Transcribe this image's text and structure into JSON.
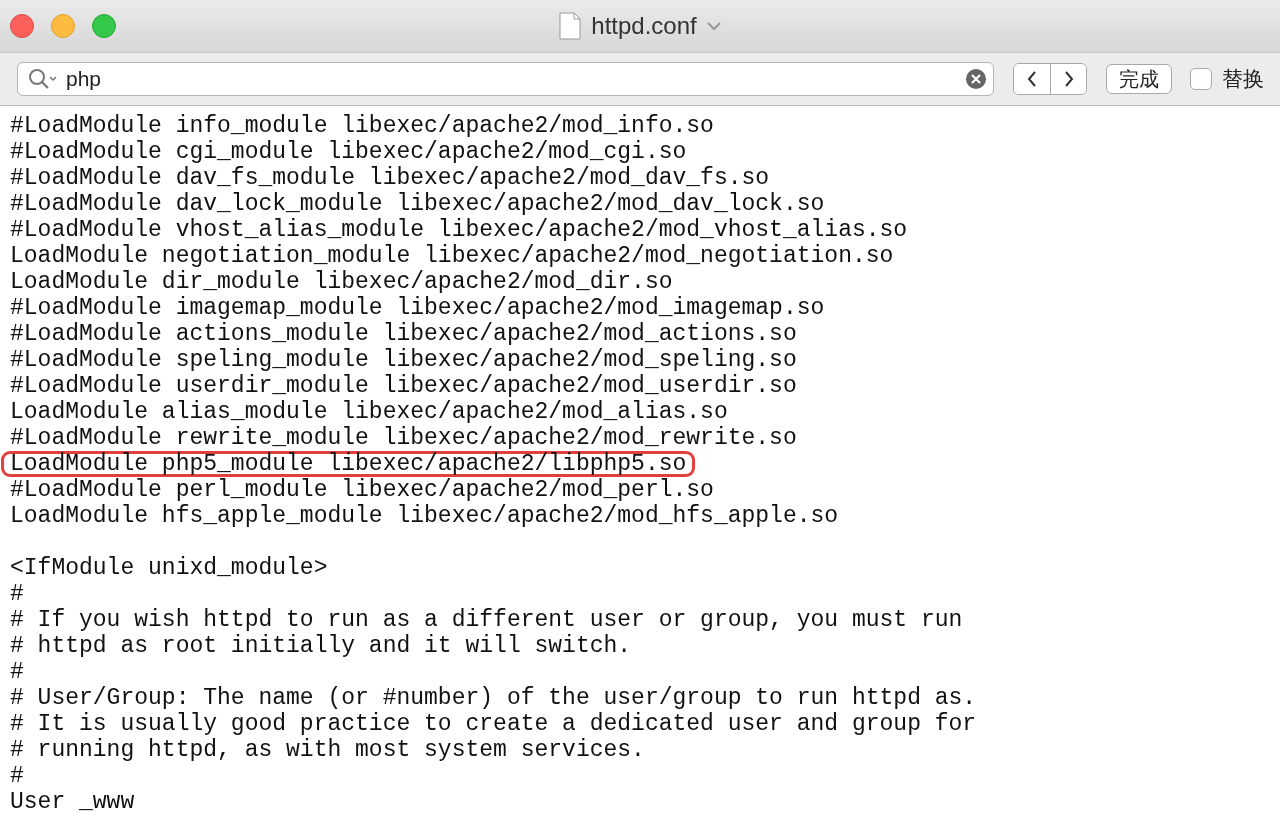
{
  "window": {
    "title": "httpd.conf"
  },
  "find_bar": {
    "query": "php",
    "done_button": "完成",
    "replace": {
      "label": "替换",
      "checked": false
    }
  },
  "lines": [
    {
      "kind": "code",
      "text": "#LoadModule info_module libexec/apache2/mod_info.so",
      "highlighted": false
    },
    {
      "kind": "code",
      "text": "#LoadModule cgi_module libexec/apache2/mod_cgi.so",
      "highlighted": false
    },
    {
      "kind": "code",
      "text": "#LoadModule dav_fs_module libexec/apache2/mod_dav_fs.so",
      "highlighted": false
    },
    {
      "kind": "code",
      "text": "#LoadModule dav_lock_module libexec/apache2/mod_dav_lock.so",
      "highlighted": false
    },
    {
      "kind": "code",
      "text": "#LoadModule vhost_alias_module libexec/apache2/mod_vhost_alias.so",
      "highlighted": false
    },
    {
      "kind": "code",
      "text": "LoadModule negotiation_module libexec/apache2/mod_negotiation.so",
      "highlighted": false
    },
    {
      "kind": "code",
      "text": "LoadModule dir_module libexec/apache2/mod_dir.so",
      "highlighted": false
    },
    {
      "kind": "code",
      "text": "#LoadModule imagemap_module libexec/apache2/mod_imagemap.so",
      "highlighted": false
    },
    {
      "kind": "code",
      "text": "#LoadModule actions_module libexec/apache2/mod_actions.so",
      "highlighted": false
    },
    {
      "kind": "code",
      "text": "#LoadModule speling_module libexec/apache2/mod_speling.so",
      "highlighted": false
    },
    {
      "kind": "code",
      "text": "#LoadModule userdir_module libexec/apache2/mod_userdir.so",
      "highlighted": false
    },
    {
      "kind": "code",
      "text": "LoadModule alias_module libexec/apache2/mod_alias.so",
      "highlighted": false
    },
    {
      "kind": "code",
      "text": "#LoadModule rewrite_module libexec/apache2/mod_rewrite.so",
      "highlighted": false
    },
    {
      "kind": "code",
      "text": "LoadModule php5_module libexec/apache2/libphp5.so",
      "highlighted": true
    },
    {
      "kind": "code",
      "text": "#LoadModule perl_module libexec/apache2/mod_perl.so",
      "highlighted": false
    },
    {
      "kind": "code",
      "text": "LoadModule hfs_apple_module libexec/apache2/mod_hfs_apple.so",
      "highlighted": false
    },
    {
      "kind": "blank"
    },
    {
      "kind": "code",
      "text": "<IfModule unixd_module>",
      "highlighted": false
    },
    {
      "kind": "code",
      "text": "#",
      "highlighted": false
    },
    {
      "kind": "code",
      "text": "# If you wish httpd to run as a different user or group, you must run",
      "highlighted": false
    },
    {
      "kind": "code",
      "text": "# httpd as root initially and it will switch.",
      "highlighted": false
    },
    {
      "kind": "code",
      "text": "#",
      "highlighted": false
    },
    {
      "kind": "code",
      "text": "# User/Group: The name (or #number) of the user/group to run httpd as.",
      "highlighted": false
    },
    {
      "kind": "code",
      "text": "# It is usually good practice to create a dedicated user and group for",
      "highlighted": false
    },
    {
      "kind": "code",
      "text": "# running httpd, as with most system services.",
      "highlighted": false
    },
    {
      "kind": "code",
      "text": "#",
      "highlighted": false
    },
    {
      "kind": "code",
      "text": "User _www",
      "highlighted": false
    }
  ]
}
